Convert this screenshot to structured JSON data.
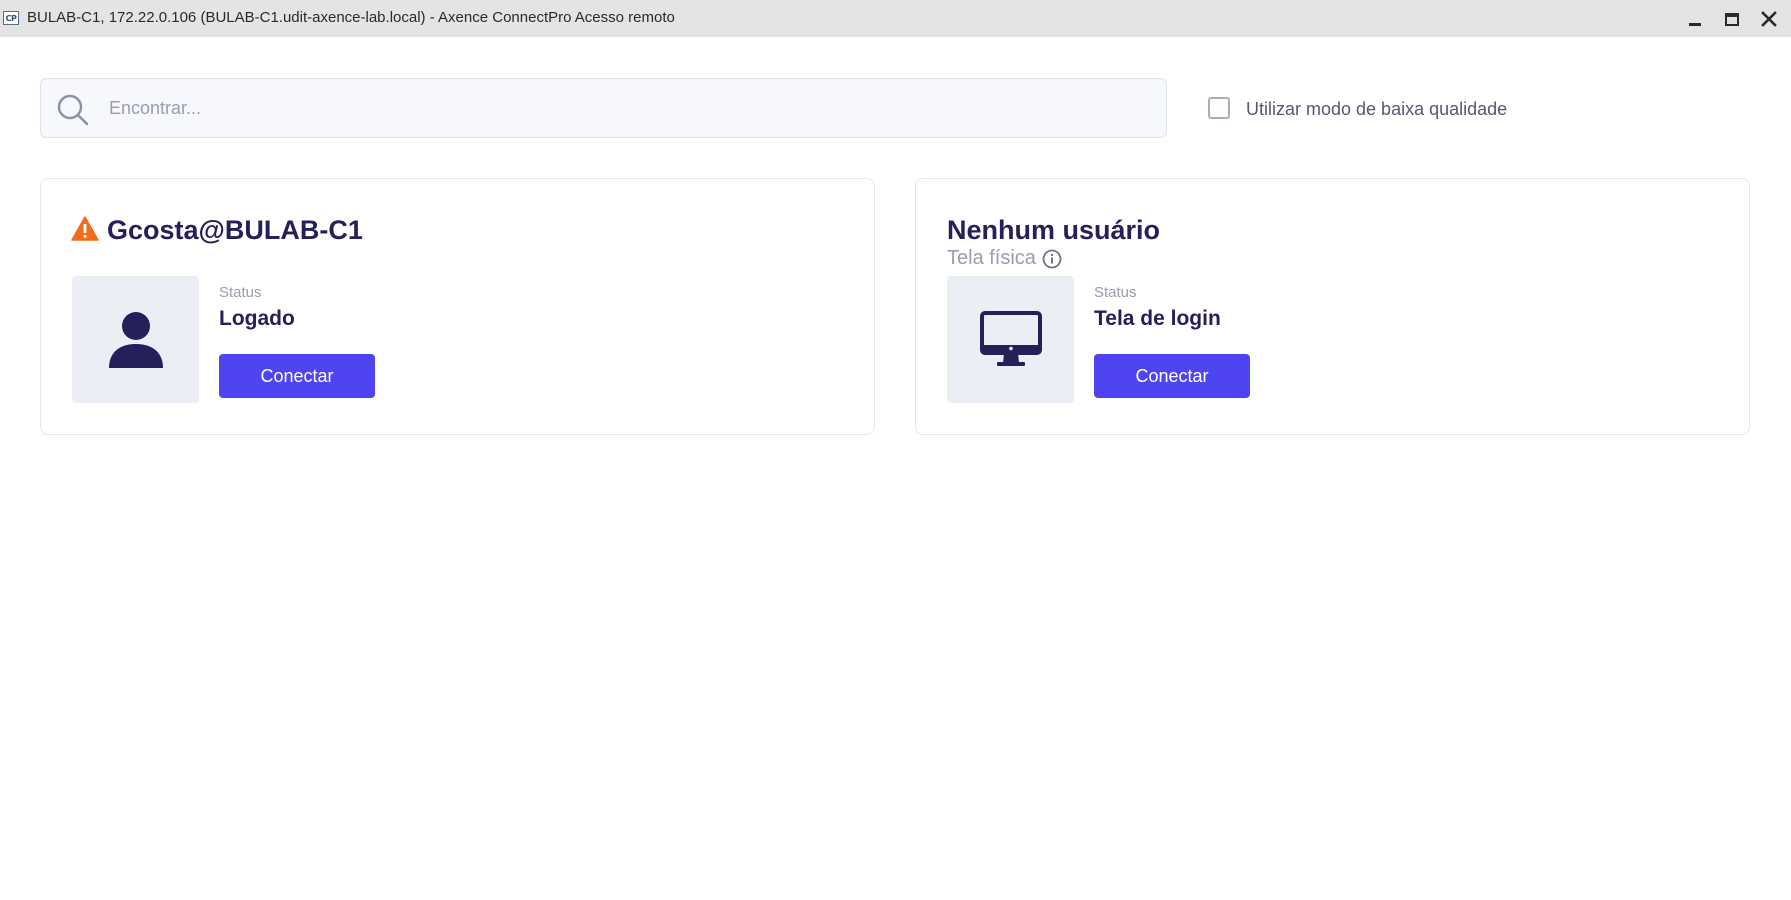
{
  "window": {
    "app_icon_text": "CP",
    "title": "BULAB-C1, 172.22.0.106 (BULAB-C1.udit-axence-lab.local) - Axence ConnectPro Acesso remoto"
  },
  "search": {
    "placeholder": "Encontrar...",
    "value": ""
  },
  "low_quality": {
    "label": "Utilizar modo de baixa qualidade",
    "checked": false
  },
  "sessions": [
    {
      "title": "Gcosta@BULAB-C1",
      "has_warning": true,
      "icon": "user-icon",
      "status_label": "Status",
      "status_value": "Logado",
      "connect_label": "Conectar"
    },
    {
      "title": "Nenhum usuário",
      "subtitle": "Tela física",
      "icon": "monitor-icon",
      "status_label": "Status",
      "status_value": "Tela de login",
      "connect_label": "Conectar"
    }
  ],
  "colors": {
    "accent": "#4f45f0",
    "text_dark": "#25205a",
    "warning": "#f26b1d",
    "muted": "#9a9cb0",
    "tile_bg": "#eceef5"
  }
}
